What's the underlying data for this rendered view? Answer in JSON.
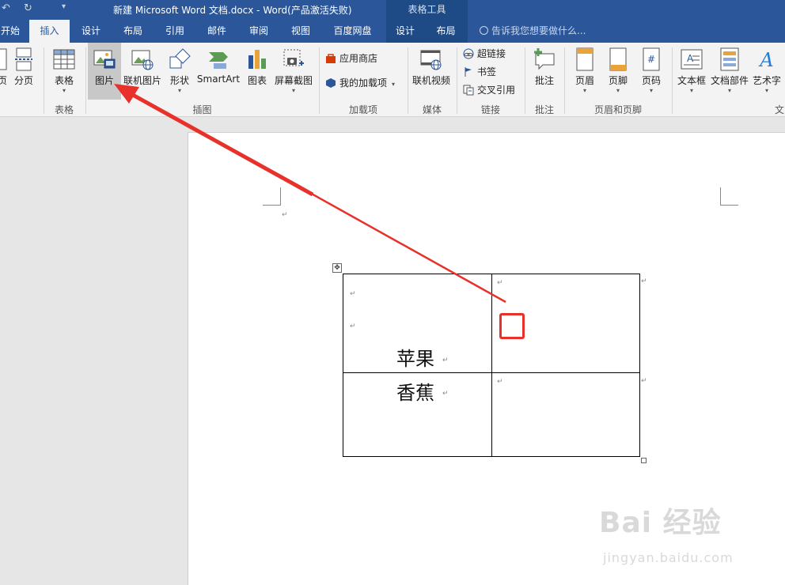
{
  "window": {
    "title": "新建 Microsoft Word 文档.docx - Word(产品激活失败)",
    "context_tool": "表格工具",
    "quick_access": [
      "undo-icon",
      "redo-icon",
      "customize-icon"
    ]
  },
  "tellme": {
    "placeholder": "告诉我您想要做什么..."
  },
  "tabs": [
    "开始",
    "插入",
    "设计",
    "布局",
    "引用",
    "邮件",
    "审阅",
    "视图",
    "百度网盘",
    "设计",
    "布局"
  ],
  "active_tab": "插入",
  "ribbon": {
    "buttons": {
      "partial_page": "页",
      "page_break": "分页",
      "table": "表格",
      "pictures": "图片",
      "online_pictures": "联机图片",
      "shapes": "形状",
      "smartart": "SmartArt",
      "chart": "图表",
      "screenshot": "屏幕截图",
      "store": "应用商店",
      "my_addins": "我的加载项",
      "online_video": "联机视频",
      "hyperlink": "超链接",
      "bookmark": "书签",
      "cross_reference": "交叉引用",
      "comment": "批注",
      "header": "页眉",
      "footer": "页脚",
      "page_number": "页码",
      "textbox": "文本框",
      "quick_parts": "文档部件",
      "wordart": "艺术字"
    },
    "groups": {
      "tables": "表格",
      "illustrations": "插图",
      "addins": "加载项",
      "media": "媒体",
      "links": "链接",
      "comments": "批注",
      "header_footer": "页眉和页脚",
      "text": "文"
    }
  },
  "document": {
    "table": {
      "cells": [
        [
          "苹果",
          ""
        ],
        [
          "香蕉",
          ""
        ]
      ]
    },
    "para_mark": "↵"
  },
  "watermark": {
    "brand": "Bai 经验",
    "url": "jingyan.baidu.com"
  },
  "colors": {
    "brand_blue": "#2b579a",
    "annotation_red": "#e8312a"
  }
}
